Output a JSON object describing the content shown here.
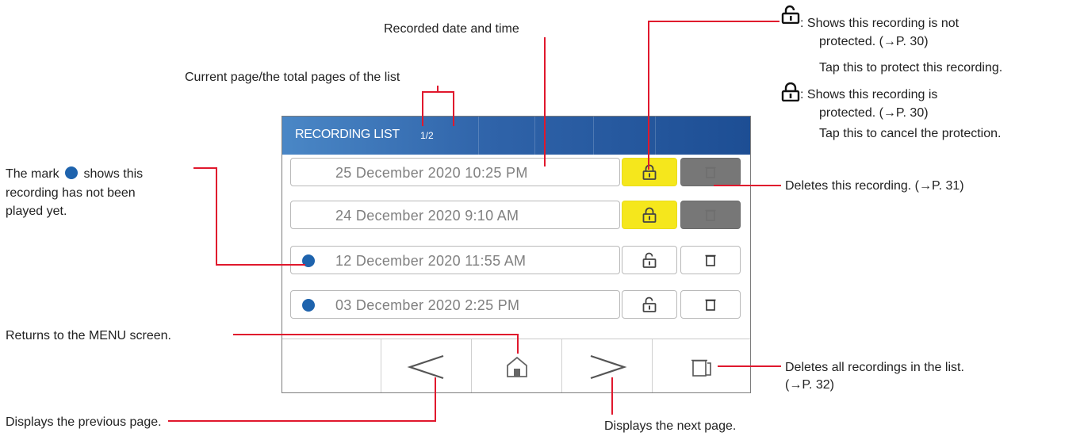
{
  "screen": {
    "title": "RECORDING LIST",
    "page_indicator": "1/2",
    "recordings": [
      {
        "date": "25 December 2020 10:25 PM",
        "unplayed": false,
        "protected": true
      },
      {
        "date": "24 December 2020 9:10 AM",
        "unplayed": false,
        "protected": true
      },
      {
        "date": "12 December 2020 11:55 AM",
        "unplayed": true,
        "protected": false
      },
      {
        "date": "03 December 2020 2:25 PM",
        "unplayed": true,
        "protected": false
      }
    ],
    "nav": [
      "prev-page",
      "menu-home",
      "next-page",
      "delete-all"
    ]
  },
  "annotations": {
    "recorded_date": "Recorded date and time",
    "current_page": "Current page/the total pages of the list",
    "unplayed_mark_1a": "The mark",
    "unplayed_mark_1b": "shows this",
    "unplayed_mark_2": "recording has not been",
    "unplayed_mark_3": "played yet.",
    "unprotected_1": ": Shows this recording is not",
    "unprotected_2": "protected. (→P. 30)",
    "unprotected_3": "Tap this to protect this recording.",
    "protected_1": ": Shows this recording is",
    "protected_2": "protected. (→P. 30)",
    "protected_3": "Tap this to cancel the protection.",
    "delete_one": "Deletes this recording. (→P. 31)",
    "menu": "Returns to the MENU screen.",
    "delete_all_1": "Deletes all recordings in the list.",
    "delete_all_2": "(→P. 32)",
    "prev_page": "Displays the previous page.",
    "next_page": "Displays the next page."
  },
  "colors": {
    "leader": "#e0182d",
    "title_bar": "#2f63a9",
    "protected_button": "#f5e71c",
    "delete_active": "#777777",
    "unplayed_dot": "#1e63ad"
  }
}
